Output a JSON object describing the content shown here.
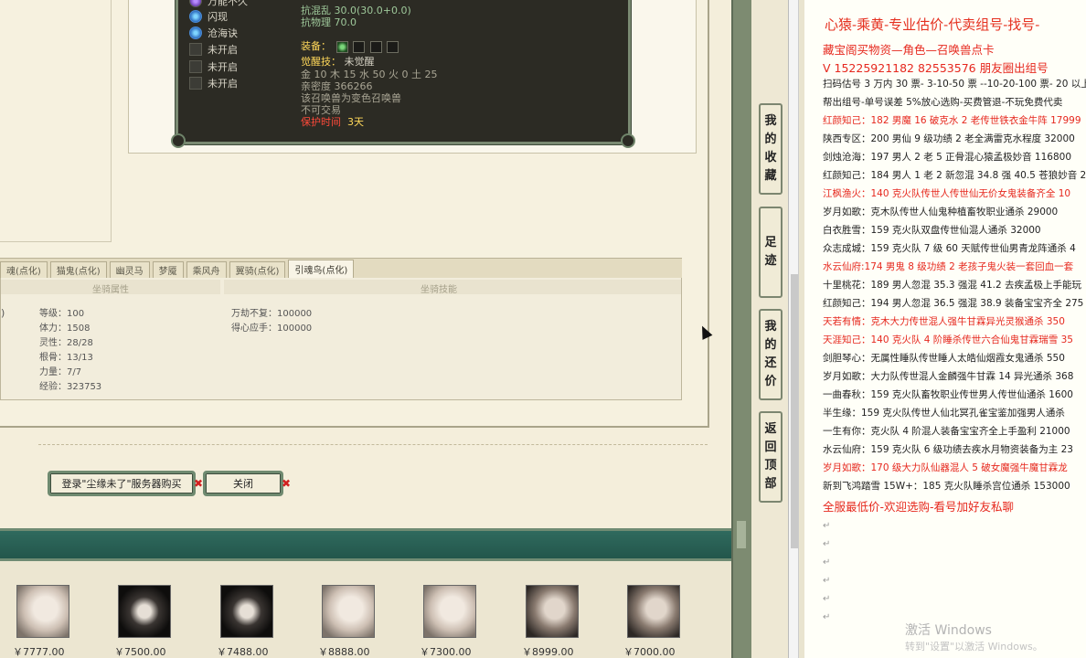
{
  "tooltip": {
    "skills": [
      "万能不久",
      "闪现",
      "沧海诀",
      "未开启",
      "未开启",
      "未开启"
    ],
    "attr_top": "抗混乱 30.0(30.0+0.0)",
    "attr_top2": "抗物理 70.0",
    "equip_label": "装备：",
    "awaken_label": "觉醒技：",
    "awaken_value": "未觉醒",
    "elements": "金 10 木 15 水 50 火 0 土 25",
    "intimacy": "亲密度 366266",
    "note1": "该召唤兽为变色召唤兽",
    "note2": "不可交易",
    "protect_label": "保护时间",
    "protect_value": "3天"
  },
  "tabs": [
    "魂(点化)",
    "猫鬼(点化)",
    "幽灵马",
    "梦魇",
    "乘风舟",
    "翼骑(点化)",
    "引魂鸟(点化)"
  ],
  "stats": {
    "left_header": "坐骑属性",
    "right_header": "坐骑技能",
    "paren": ")",
    "rows": [
      "等级：100",
      "体力：1508",
      "灵性：28/28",
      "根骨：13/13",
      "力量：7/7",
      "经验：323753"
    ],
    "skills": [
      "万劫不复：100000",
      "得心应手：100000"
    ]
  },
  "buttons": {
    "login_label": "登录\"尘缘未了\"服务器购买",
    "close_label": "关闭",
    "x_mark": "✖"
  },
  "characters": [
    {
      "price": "￥7777.00",
      "tone": "light"
    },
    {
      "price": "￥7500.00",
      "tone": "dark"
    },
    {
      "price": "￥7488.00",
      "tone": "dark"
    },
    {
      "price": "￥8888.00",
      "tone": "light"
    },
    {
      "price": "￥7300.00",
      "tone": "light"
    },
    {
      "price": "￥8999.00",
      "tone": "mid"
    },
    {
      "price": "￥7000.00",
      "tone": "mid"
    }
  ],
  "float_buttons": [
    [
      "我",
      "的",
      "收",
      "藏"
    ],
    [
      "足",
      "迹"
    ],
    [
      "我",
      "的",
      "还",
      "价"
    ],
    [
      "返",
      "回",
      "顶",
      "部"
    ]
  ],
  "doc": {
    "title": "心猿-乘黄-专业估价-代卖组号-找号-",
    "lines": [
      {
        "text": "藏宝阁买物资—角色—召唤兽点卡",
        "style": "red big"
      },
      {
        "text": "V 15225921182  82553576 朋友圈出组号",
        "style": "red big"
      },
      {
        "text": "扫码估号 3 万内 30 票- 3-10-50 票 --10-20-100 票- 20 以上 1",
        "style": ""
      },
      {
        "text": "帮出组号-单号误差 5%放心选购-买费管退-不玩免费代卖",
        "style": ""
      },
      {
        "text": "红颜知己：182 男魔 16 破克水 2 老传世铁衣金牛阵 17999",
        "style": "red"
      },
      {
        "text": "陕西专区：200 男仙 9 级功绩 2 老全满雷克水程度 32000",
        "style": ""
      },
      {
        "text": "剑烛沧海：197 男人 2 老 5 正骨混心猿孟极妙音 116800",
        "style": ""
      },
      {
        "text": "红颜知己：184 男人 1 老 2 新忽混 34.8 强 40.5 苍狼妙音 2",
        "style": ""
      },
      {
        "text": "江枫渔火：140 克火队传世人传世仙无价女鬼装备齐全 10",
        "style": "red"
      },
      {
        "text": "岁月如歌：克木队传世人仙鬼种植畜牧职业通杀 29000",
        "style": ""
      },
      {
        "text": "白衣胜雪：159 克火队双盘传世仙混人通杀 32000",
        "style": ""
      },
      {
        "text": "众志成城：159 克火队 7 级 60 天赋传世仙男青龙阵通杀 4",
        "style": ""
      },
      {
        "text": "水云仙府:174 男鬼 8 级功绩 2 老孩子鬼火装一套回血一套",
        "style": "red"
      },
      {
        "text": "十里桃花：189 男人忽混 35.3 强混 41.2 去疾孟极上手能玩",
        "style": ""
      },
      {
        "text": "红颜知己：194 男人忽混 36.5 强混 38.9 装备宝宝齐全 275",
        "style": ""
      },
      {
        "text": "天若有情：克木大力传世混人强牛甘霖异光灵猴通杀 350",
        "style": "red"
      },
      {
        "text": "天涯知己：140 克火队 4 阶睡杀传世六合仙鬼甘霖瑞雪 35",
        "style": "red"
      },
      {
        "text": "剑胆琴心：无属性睡队传世睡人太皓仙烟霞女鬼通杀 550",
        "style": ""
      },
      {
        "text": "岁月如歌：大力队传世混人金麟强牛甘霖 14 异光通杀 368",
        "style": ""
      },
      {
        "text": "一曲春秋：159 克火队畜牧职业传世男人传世仙通杀 1600",
        "style": ""
      },
      {
        "text": "半生缘：159 克火队传世人仙北冥孔雀宝鉴加强男人通杀",
        "style": ""
      },
      {
        "text": "一生有你：克火队 4 阶混人装备宝宝齐全上手盈利 21000",
        "style": ""
      },
      {
        "text": "水云仙府：159 克火队 6 级功绩去疾水月物资装备为主 23",
        "style": ""
      },
      {
        "text": "岁月如歌：170 级大力队仙器混人 5 破女魔强牛魔甘霖龙",
        "style": "red"
      },
      {
        "text": "新到飞鸿踏雪 15W+：185 克火队睡杀宫位通杀 153000",
        "style": ""
      },
      {
        "text": "全服最低价-欢迎选购-看号加好友私聊",
        "style": "red big"
      }
    ],
    "para_mark": "↵"
  },
  "watermark": {
    "line1": "激活 Windows",
    "line2": "转到\"设置\"以激活 Windows。"
  }
}
